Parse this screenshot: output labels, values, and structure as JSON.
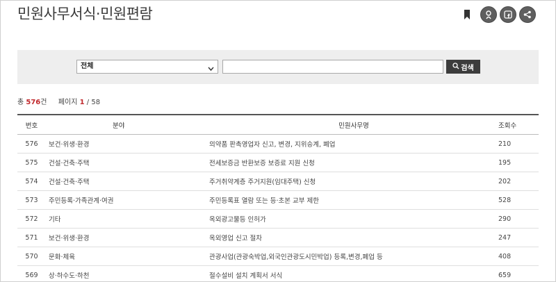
{
  "page_title": "민원사무서식·민원편람",
  "icons": [
    "bookmark-icon",
    "kakao-story-icon",
    "facebook-icon",
    "share-icon"
  ],
  "search": {
    "category_selected": "전체",
    "query_value": "",
    "query_placeholder": "",
    "button_label": "검색"
  },
  "summary": {
    "total_prefix": "총",
    "total_count": "576",
    "total_suffix": "건",
    "page_label": "페이지",
    "current_page": "1",
    "total_pages": "/ 58"
  },
  "table": {
    "headers": {
      "num": "번호",
      "category": "분야",
      "name": "민원사무명",
      "views": "조회수"
    },
    "rows": [
      {
        "num": "576",
        "category": "보건·위생·환경",
        "name": "의약품 판촉영업자 신고, 변경, 지위승계, 폐업",
        "views": "210"
      },
      {
        "num": "575",
        "category": "건설·건축·주택",
        "name": "전세보증금 반환보증 보증료 지원 신청",
        "views": "195"
      },
      {
        "num": "574",
        "category": "건설·건축·주택",
        "name": "주거취약계층 주거지원(임대주택) 신청",
        "views": "202"
      },
      {
        "num": "573",
        "category": "주민등록·가족관계·여권",
        "name": "주민등록표 열람 또는 등·초본 교부 제한",
        "views": "528"
      },
      {
        "num": "572",
        "category": "기타",
        "name": "옥외광고물등 인허가",
        "views": "290"
      },
      {
        "num": "571",
        "category": "보건·위생·환경",
        "name": "옥외영업 신고 절차",
        "views": "247"
      },
      {
        "num": "570",
        "category": "문화·체육",
        "name": "관광사업(관광숙박업,외국인관광도시민박업) 등록,변경,폐업 등",
        "views": "408"
      },
      {
        "num": "569",
        "category": "상·하수도·하천",
        "name": "절수설비 설치 계획서 서식",
        "views": "659"
      }
    ]
  }
}
